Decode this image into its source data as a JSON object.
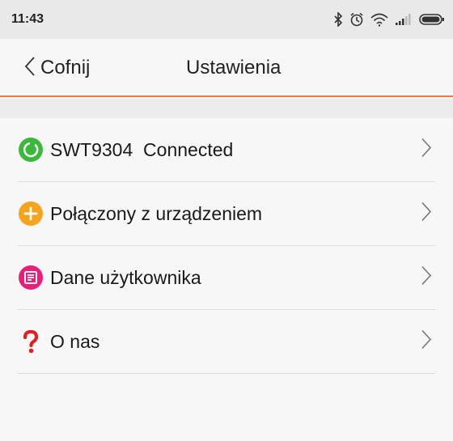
{
  "status_bar": {
    "time": "11:43",
    "icons": [
      "bluetooth-icon",
      "alarm-icon",
      "wifi-icon",
      "signal-icon",
      "battery-icon"
    ]
  },
  "nav": {
    "back_label": "Cofnij",
    "title": "Ustawienia",
    "accent_color": "#f07a3e"
  },
  "list": {
    "items": [
      {
        "label": "SWT9304  Connected",
        "icon": "connected-status-icon",
        "icon_color": "#3cb83c"
      },
      {
        "label": "Połączony z urządzeniem",
        "icon": "add-device-icon",
        "icon_color": "#f5a41d"
      },
      {
        "label": "Dane użytkownika",
        "icon": "user-data-icon",
        "icon_color": "#e8207a"
      },
      {
        "label": "O nas",
        "icon": "question-mark-icon",
        "icon_color": "#e02020"
      }
    ]
  }
}
